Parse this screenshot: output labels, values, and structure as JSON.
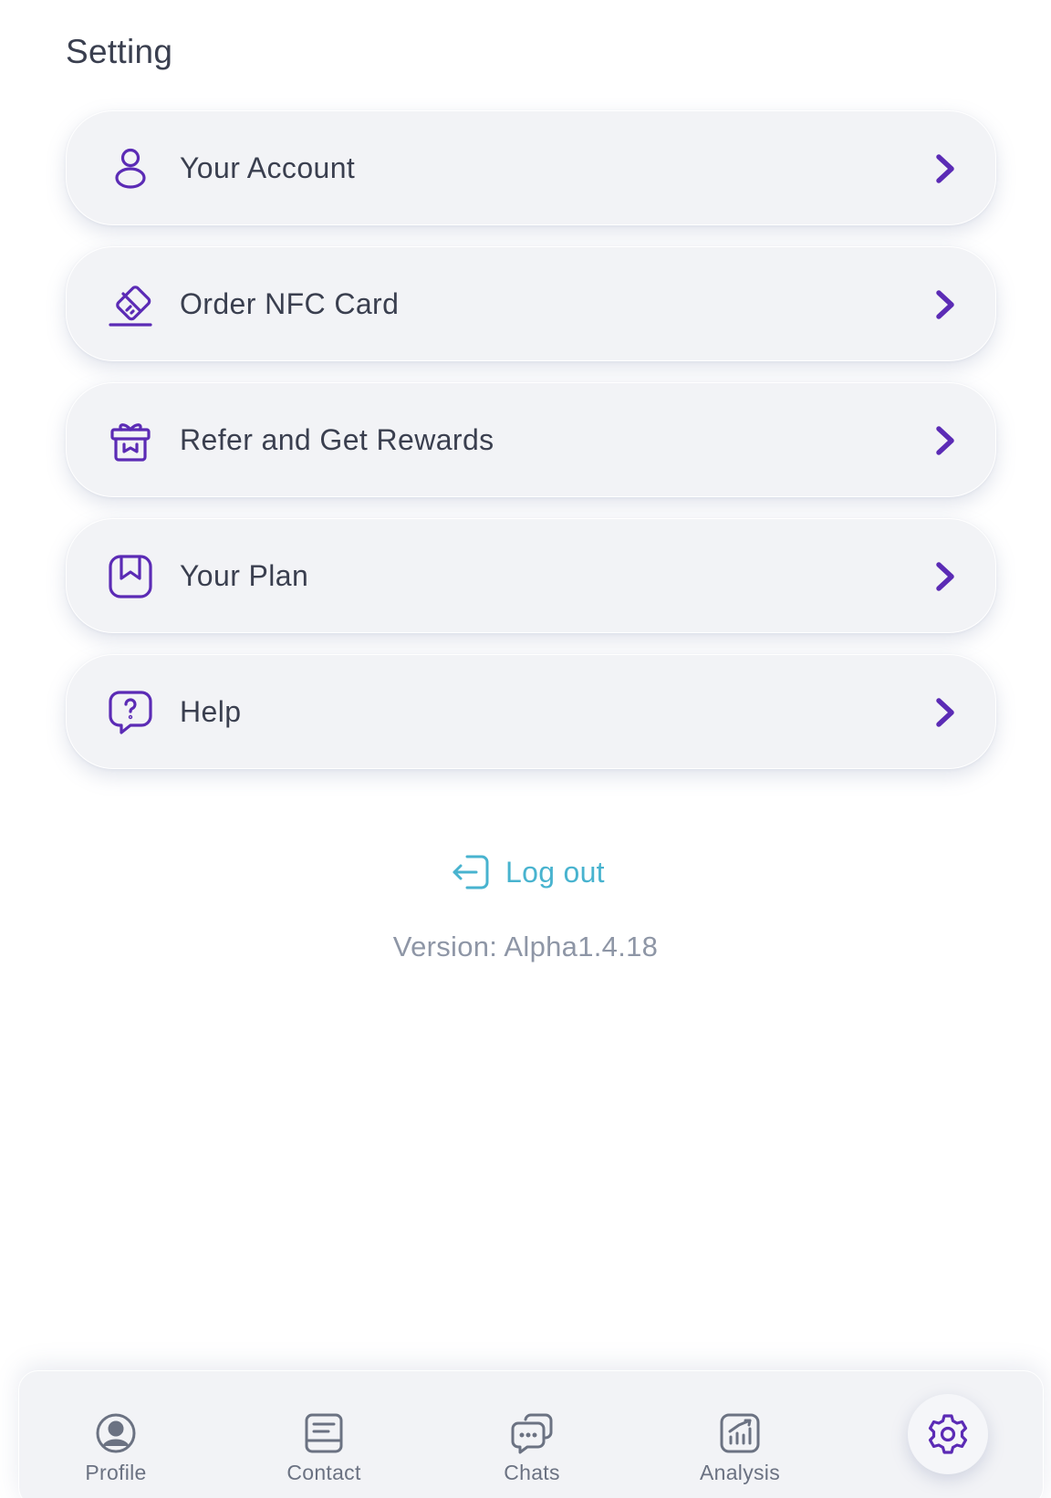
{
  "header": {
    "title": "Setting"
  },
  "menu": {
    "items": [
      {
        "label": "Your Account",
        "icon": "user-icon"
      },
      {
        "label": "Order NFC Card",
        "icon": "card-icon"
      },
      {
        "label": "Refer and Get Rewards",
        "icon": "gift-icon"
      },
      {
        "label": "Your Plan",
        "icon": "bookmark-icon"
      },
      {
        "label": "Help",
        "icon": "help-chat-icon"
      }
    ]
  },
  "logout": {
    "label": "Log out",
    "icon": "logout-icon"
  },
  "version": {
    "text": "Version: Alpha1.4.18"
  },
  "bottom_nav": {
    "items": [
      {
        "label": "Profile",
        "icon": "profile-icon"
      },
      {
        "label": "Contact",
        "icon": "contact-icon"
      },
      {
        "label": "Chats",
        "icon": "chats-icon"
      },
      {
        "label": "Analysis",
        "icon": "analysis-icon"
      }
    ],
    "active": {
      "icon": "settings-gear-icon"
    }
  },
  "colors": {
    "accent": "#5b2bb5",
    "logout": "#48b3cf",
    "text": "#3a3f4f",
    "muted": "#8e96a6",
    "nav_icon": "#6b7282"
  }
}
